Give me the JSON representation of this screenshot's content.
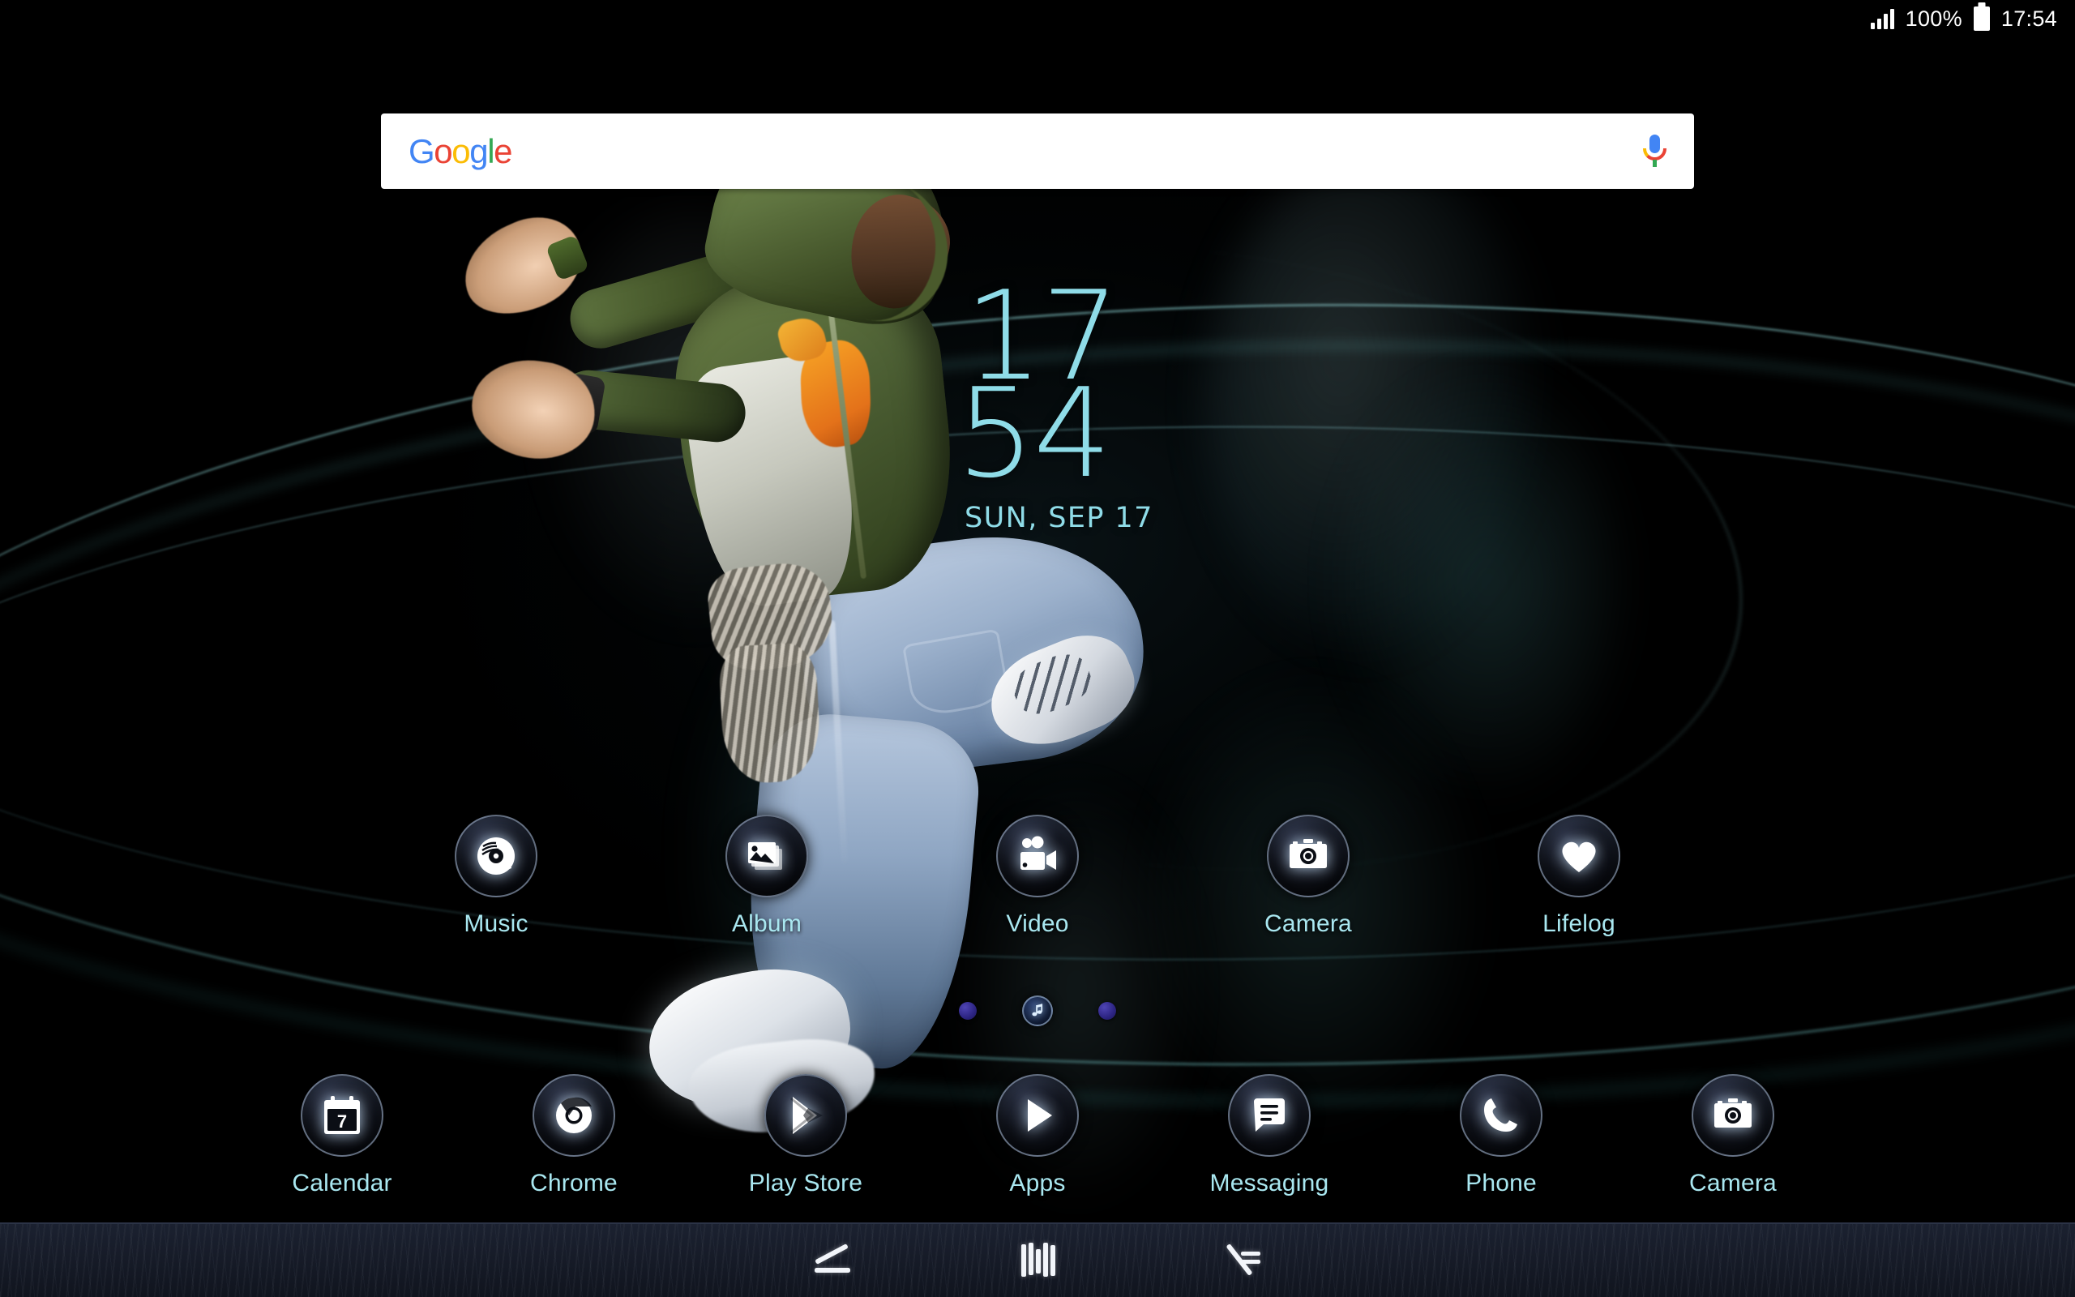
{
  "status_bar": {
    "signal_icon": "signal-bars-icon",
    "battery_percent": "100%",
    "battery_icon": "battery-full-icon",
    "time": "17:54"
  },
  "search_widget": {
    "logo_letters": [
      "G",
      "o",
      "o",
      "g",
      "l",
      "e"
    ],
    "mic_icon": "microphone-icon",
    "placeholder": ""
  },
  "clock_widget": {
    "hours": "17",
    "minutes": "54",
    "date": "SUN, SEP 17",
    "color": "#8FDCE8"
  },
  "home_apps": [
    {
      "label": "Music",
      "icon": "vinyl-record-icon"
    },
    {
      "label": "Album",
      "icon": "photo-stack-icon"
    },
    {
      "label": "Video",
      "icon": "camcorder-icon"
    },
    {
      "label": "Camera",
      "icon": "camera-icon"
    },
    {
      "label": "Lifelog",
      "icon": "heart-icon"
    }
  ],
  "page_indicator": {
    "pages": 3,
    "active_index": 1,
    "active_icon": "music-note-icon",
    "dot_color": "#2C2482"
  },
  "dock_apps": [
    {
      "label": "Calendar",
      "icon": "calendar-icon",
      "badge_number": "7"
    },
    {
      "label": "Chrome",
      "icon": "chrome-icon"
    },
    {
      "label": "Play Store",
      "icon": "play-store-icon"
    },
    {
      "label": "Apps",
      "icon": "apps-play-icon"
    },
    {
      "label": "Messaging",
      "icon": "message-bubble-icon"
    },
    {
      "label": "Phone",
      "icon": "phone-handset-icon"
    },
    {
      "label": "Camera",
      "icon": "camera-icon"
    }
  ],
  "nav_bar": {
    "back": {
      "label": "Back",
      "icon": "back-angle-icon"
    },
    "home": {
      "label": "Home",
      "icon": "home-bars-icon"
    },
    "recents": {
      "label": "Recent apps",
      "icon": "recents-lines-icon"
    }
  },
  "wallpaper": {
    "description": "Dancer in green hoodie with cyan smoke on black background",
    "accent_color": "#7FD4DC",
    "background_color": "#000000"
  },
  "theme": {
    "label_color": "#A9E7F0",
    "icon_badge_border": "#B0C4DE"
  }
}
